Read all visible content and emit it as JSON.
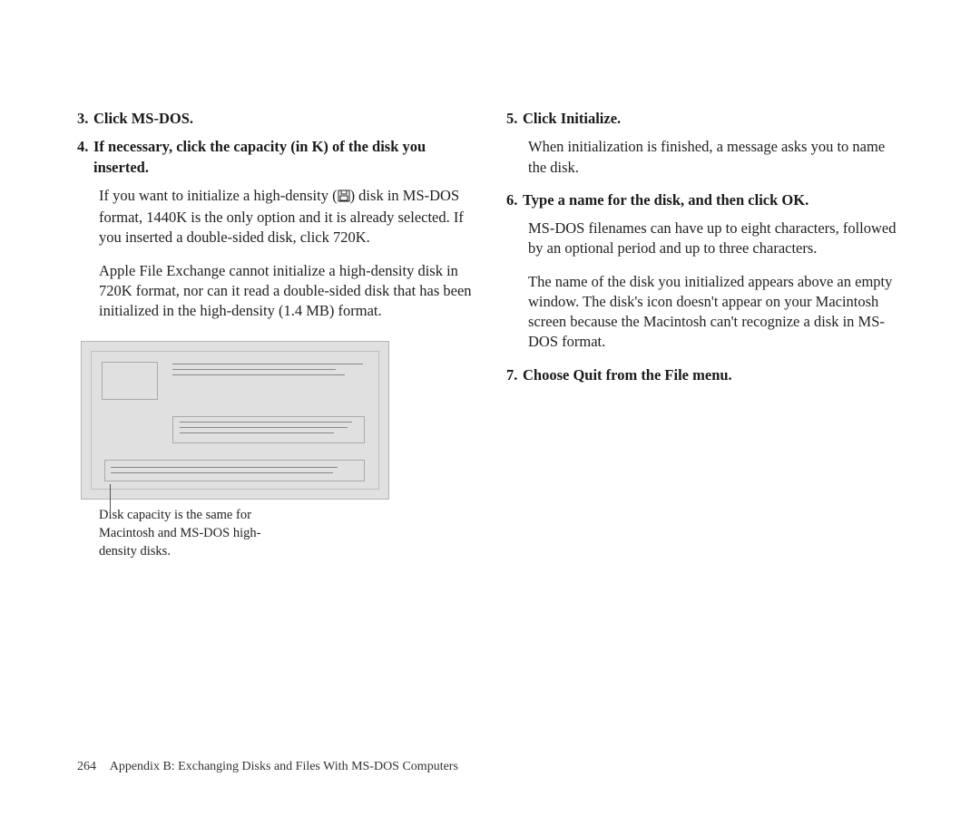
{
  "left_column": {
    "step3": {
      "number": "3.",
      "title": "Click MS-DOS."
    },
    "step4": {
      "number": "4.",
      "title": "If necessary, click the capacity (in K) of the disk you inserted.",
      "para1a": "If you want to initialize a high-density (",
      "para1b": ") disk in MS-DOS format, 1440K is the only option and it is already selected. If you inserted a double-sided disk, click 720K.",
      "para2": "Apple File Exchange cannot initialize a high-density disk in 720K format, nor can it read a double-sided disk that has been initialized in the high-density (1.4 MB) format.",
      "caption": "Disk capacity is the same for Macintosh and MS-DOS high-density disks."
    }
  },
  "right_column": {
    "step5": {
      "number": "5.",
      "title": "Click Initialize.",
      "para1": "When initialization is finished, a message asks you to name the disk."
    },
    "step6": {
      "number": "6.",
      "title": "Type a name for the disk, and then click OK.",
      "para1": "MS-DOS filenames can have up to eight characters, followed by an optional period and up to three characters.",
      "para2": "The name of the disk you initialized appears above an empty window. The disk's icon doesn't appear on your Macintosh screen because the Macintosh can't recognize a disk in MS-DOS format."
    },
    "step7": {
      "number": "7.",
      "title": "Choose Quit from the File menu."
    }
  },
  "footer": {
    "page_number": "264",
    "text": "Appendix B: Exchanging Disks and Files With MS-DOS Computers"
  }
}
